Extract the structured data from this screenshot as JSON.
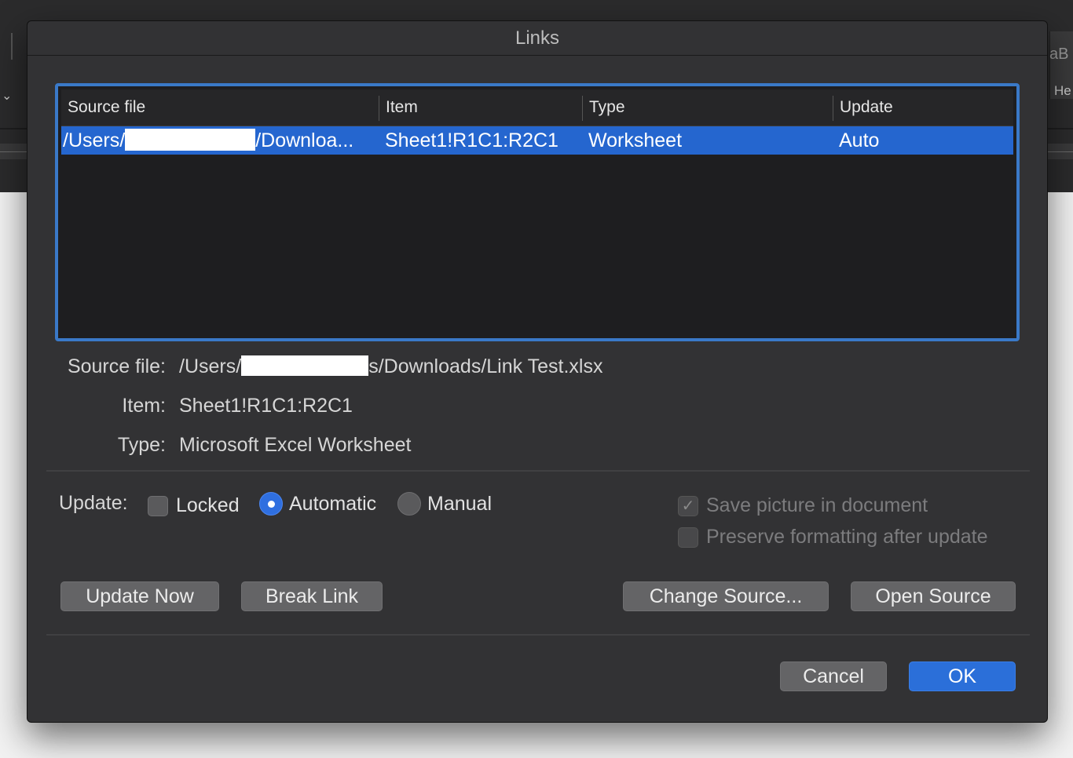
{
  "background": {
    "style_preview_text": "aB",
    "style_heading_text": "He"
  },
  "dialog": {
    "title": "Links",
    "table": {
      "columns": [
        "Source file",
        "Item",
        "Type",
        "Update"
      ],
      "rows": [
        {
          "source_prefix": "/Users/",
          "source_suffix": "/Downloa...",
          "item": "Sheet1!R1C1:R2C1",
          "type": "Worksheet",
          "update": "Auto"
        }
      ]
    },
    "details": {
      "source_label": "Source file:",
      "source_prefix": "/Users/",
      "source_suffix": "s/Downloads/Link Test.xlsx",
      "item_label": "Item:",
      "item_value": "Sheet1!R1C1:R2C1",
      "type_label": "Type:",
      "type_value": "Microsoft Excel Worksheet"
    },
    "update": {
      "label": "Update:",
      "locked_label": "Locked",
      "locked_checked": false,
      "automatic_label": "Automatic",
      "manual_label": "Manual",
      "selected": "Automatic",
      "save_picture_label": "Save picture in document",
      "save_picture_checked": true,
      "preserve_formatting_label": "Preserve formatting after update",
      "preserve_formatting_checked": false
    },
    "buttons": {
      "update_now": "Update Now",
      "break_link": "Break Link",
      "change_source": "Change Source...",
      "open_source": "Open Source",
      "cancel": "Cancel",
      "ok": "OK"
    },
    "colors": {
      "selection": "#2566cf",
      "focus_ring": "#3a79c8",
      "primary_button": "#2b6fd9"
    }
  }
}
